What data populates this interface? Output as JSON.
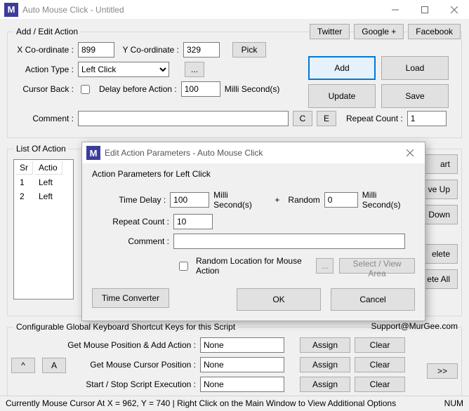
{
  "window": {
    "title": "Auto Mouse Click - Untitled",
    "icon_letter": "M"
  },
  "social": {
    "twitter": "Twitter",
    "google": "Google +",
    "facebook": "Facebook"
  },
  "addEdit": {
    "legend": "Add / Edit Action",
    "xLabel": "X Co-ordinate :",
    "xValue": "899",
    "yLabel": "Y Co-ordinate :",
    "yValue": "329",
    "pick": "Pick",
    "actionTypeLabel": "Action Type :",
    "actionTypeValue": "Left Click",
    "ellipsis": "...",
    "cursorBackLabel": "Cursor Back :",
    "delayLabel": "Delay before Action :",
    "delayValue": "100",
    "delayUnit": "Milli Second(s)",
    "commentLabel": "Comment :",
    "commentValue": "",
    "cBtn": "C",
    "eBtn": "E",
    "repeatLabel": "Repeat Count :",
    "repeatValue": "1",
    "addBtn": "Add",
    "loadBtn": "Load",
    "updateBtn": "Update",
    "saveBtn": "Save"
  },
  "actionsList": {
    "legend": "List Of Action",
    "headers": {
      "sr": "Sr",
      "action": "Actio"
    },
    "rows": [
      {
        "sr": "1",
        "action": "Left"
      },
      {
        "sr": "2",
        "action": "Left"
      }
    ],
    "sideButtons": {
      "start": "art",
      "moveUp": "ve Up",
      "moveDown": "Down",
      "delete": "elete",
      "deleteAll": "ete All"
    }
  },
  "shortcuts": {
    "legend": "Configurable Global Keyboard Shortcut Keys for this Script",
    "support": "Support@MurGee.com",
    "rows": [
      {
        "label": "Get Mouse Position & Add Action :",
        "value": "None",
        "assign": "Assign",
        "clear": "Clear"
      },
      {
        "label": "Get Mouse Cursor Position :",
        "value": "None",
        "assign": "Assign",
        "clear": "Clear"
      },
      {
        "label": "Start / Stop Script Execution :",
        "value": "None",
        "assign": "Assign",
        "clear": "Clear"
      }
    ],
    "moreBtn": ">>",
    "caretBtn": "^",
    "aBtn": "A"
  },
  "status": {
    "text": "Currently Mouse Cursor At X = 962, Y = 740 | Right Click on the Main Window to View Additional Options",
    "num": "NUM"
  },
  "dialog": {
    "title": "Edit Action Parameters - Auto Mouse Click",
    "icon_letter": "M",
    "heading": "Action Parameters for Left Click",
    "timeDelayLabel": "Time Delay :",
    "timeDelayValue": "100",
    "timeDelayUnit": "Milli Second(s)",
    "plus": "+",
    "random": "Random",
    "randomValue": "0",
    "randomUnit": "Milli Second(s)",
    "repeatLabel": "Repeat Count :",
    "repeatValue": "10",
    "commentLabel": "Comment :",
    "commentValue": "",
    "randomLocLabel": "Random Location for Mouse Action",
    "ellipsis": "...",
    "selectView": "Select / View Area",
    "timeConverter": "Time Converter",
    "ok": "OK",
    "cancel": "Cancel"
  }
}
